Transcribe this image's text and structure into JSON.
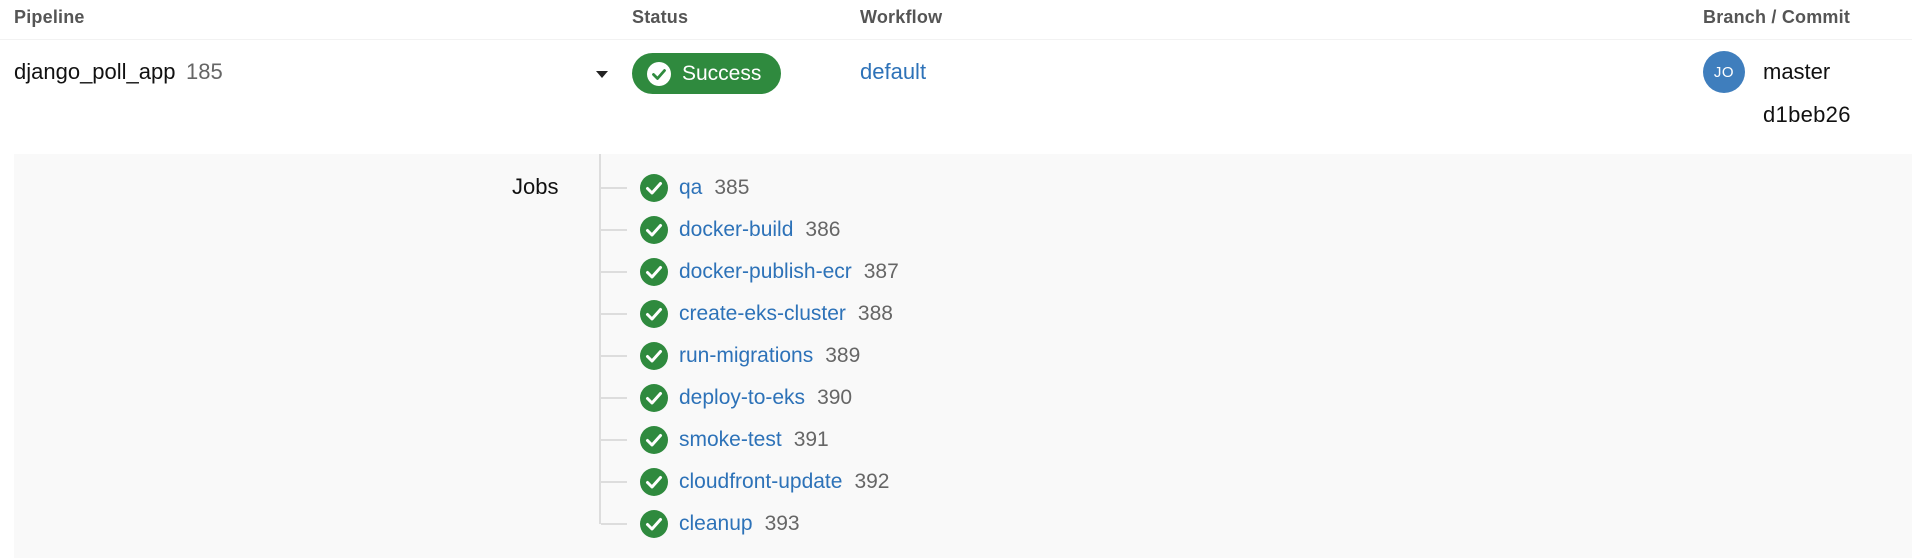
{
  "columns": {
    "pipeline": "Pipeline",
    "status": "Status",
    "workflow": "Workflow",
    "branch_commit": "Branch / Commit"
  },
  "pipeline": {
    "name": "django_poll_app",
    "number": "185",
    "status": "Success",
    "workflow": "default",
    "avatar_initials": "JO",
    "branch": "master",
    "commit": "d1beb26"
  },
  "jobs": {
    "label": "Jobs",
    "items": [
      {
        "name": "qa",
        "number": "385"
      },
      {
        "name": "docker-build",
        "number": "386"
      },
      {
        "name": "docker-publish-ecr",
        "number": "387"
      },
      {
        "name": "create-eks-cluster",
        "number": "388"
      },
      {
        "name": "run-migrations",
        "number": "389"
      },
      {
        "name": "deploy-to-eks",
        "number": "390"
      },
      {
        "name": "smoke-test",
        "number": "391"
      },
      {
        "name": "cloudfront-update",
        "number": "392"
      },
      {
        "name": "cleanup",
        "number": "393"
      }
    ]
  },
  "colors": {
    "success": "#2f8a3e",
    "link": "#2d72b8",
    "avatar": "#3f7ebd"
  },
  "icons": {
    "status": "check-circle-icon",
    "toggle": "caret-down-icon",
    "job_status": "check-circle-icon"
  }
}
